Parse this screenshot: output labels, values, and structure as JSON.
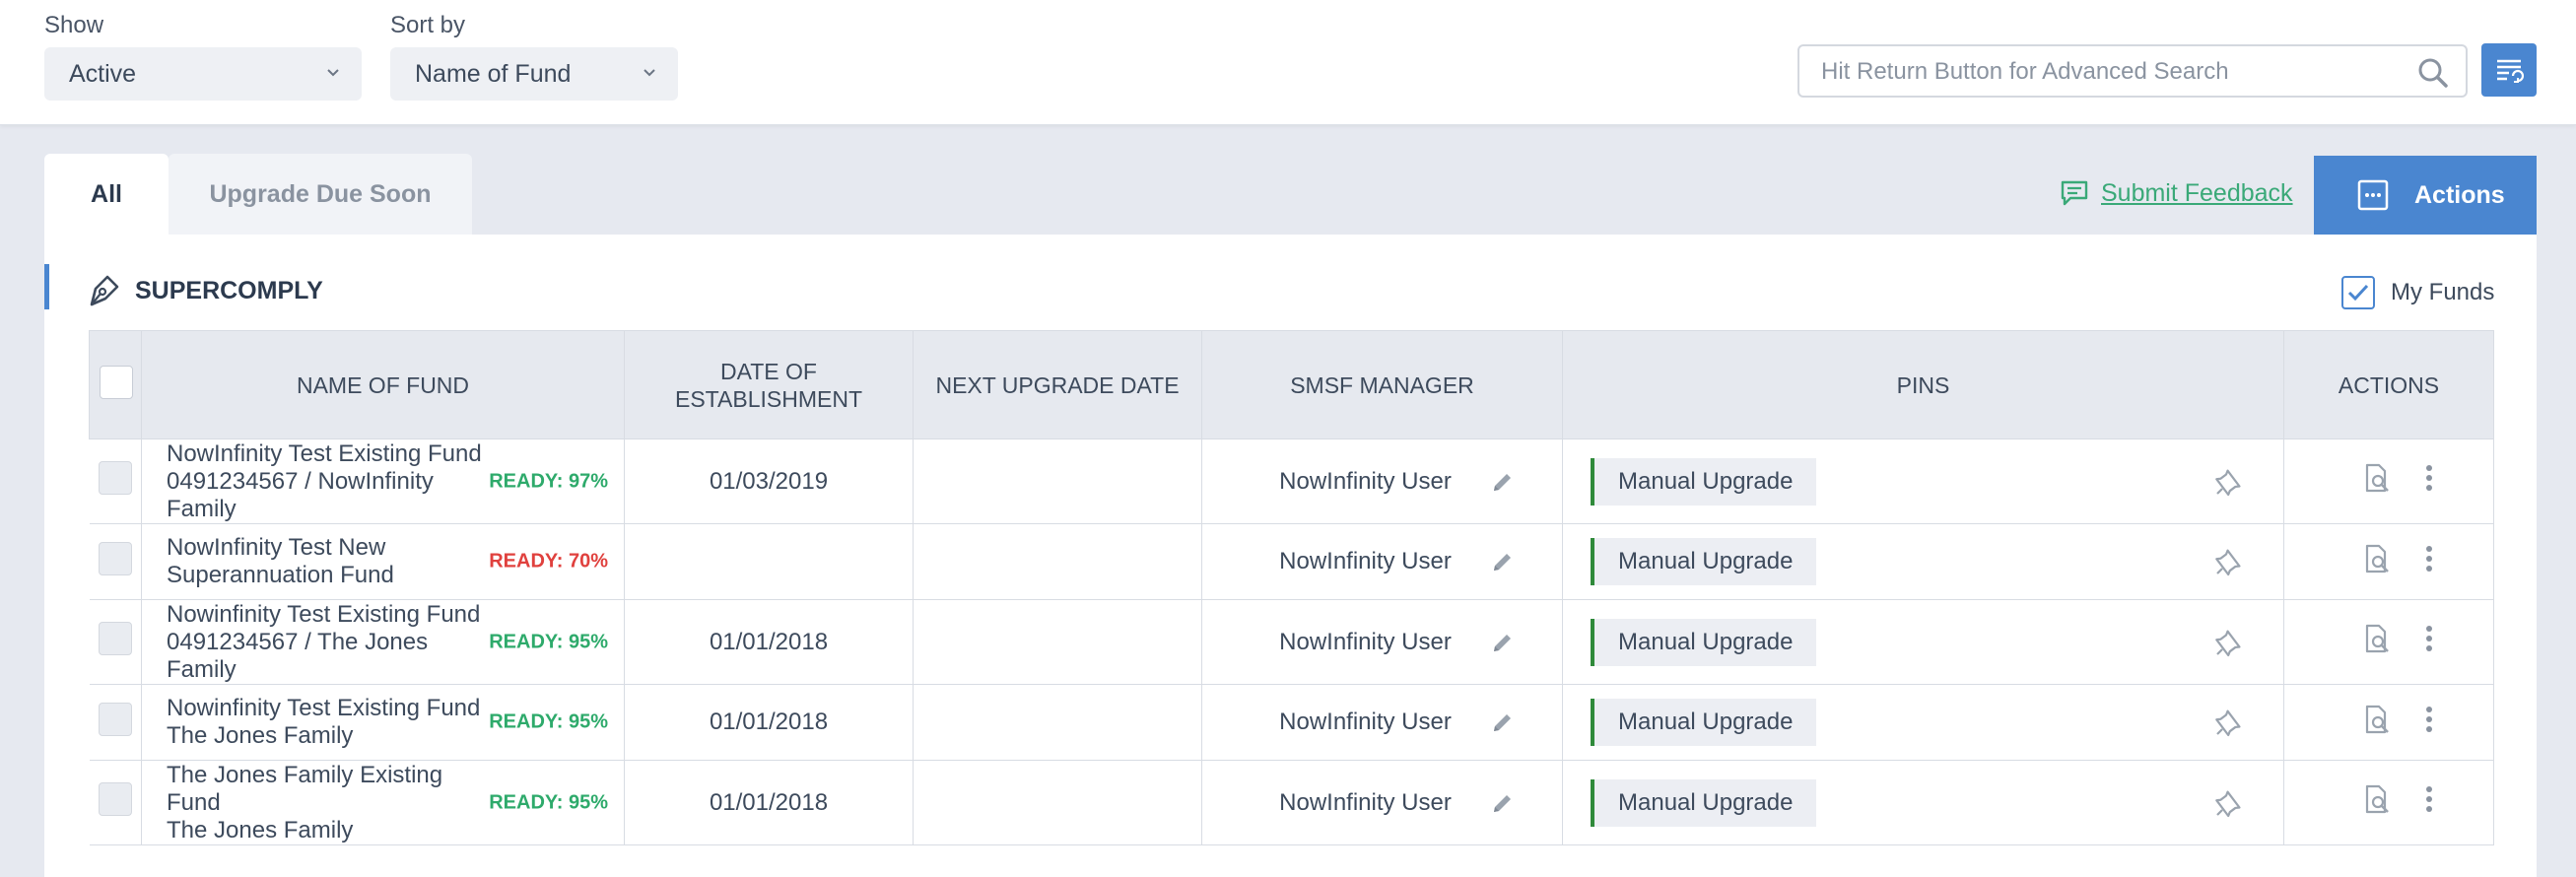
{
  "filters": {
    "show_label": "Show",
    "show_value": "Active",
    "sort_label": "Sort by",
    "sort_value": "Name of Fund"
  },
  "search": {
    "placeholder": "Hit Return Button for Advanced Search"
  },
  "tabs": [
    {
      "label": "All",
      "active": true
    },
    {
      "label": "Upgrade Due Soon",
      "active": false
    }
  ],
  "feedback_label": "Submit Feedback",
  "actions_label": "Actions",
  "section": {
    "title": "SUPERCOMPLY",
    "my_funds_label": "My Funds",
    "my_funds_checked": true
  },
  "table": {
    "columns": [
      "NAME OF FUND",
      "DATE OF ESTABLISHMENT",
      "NEXT UPGRADE DATE",
      "SMSF MANAGER",
      "PINS",
      "ACTIONS"
    ],
    "rows": [
      {
        "name_lines": [
          "NowInfinity Test Existing Fund",
          "0491234567 / NowInfinity",
          "Family"
        ],
        "ready": "READY: 97%",
        "ready_color": "#2eaa6b",
        "date": "01/03/2019",
        "next_upgrade": "",
        "manager": "NowInfinity User",
        "pin": "Manual Upgrade"
      },
      {
        "name_lines": [
          "NowInfinity Test New",
          "Superannuation Fund"
        ],
        "ready": "READY: 70%",
        "ready_color": "#e0413e",
        "date": "",
        "next_upgrade": "",
        "manager": "NowInfinity User",
        "pin": "Manual Upgrade"
      },
      {
        "name_lines": [
          "Nowinfinity Test Existing Fund",
          "0491234567 / The Jones",
          "Family"
        ],
        "ready": "READY: 95%",
        "ready_color": "#2eaa6b",
        "date": "01/01/2018",
        "next_upgrade": "",
        "manager": "NowInfinity User",
        "pin": "Manual Upgrade"
      },
      {
        "name_lines": [
          "Nowinfinity Test Existing Fund",
          "The Jones Family"
        ],
        "ready": "READY: 95%",
        "ready_color": "#2eaa6b",
        "date": "01/01/2018",
        "next_upgrade": "",
        "manager": "NowInfinity User",
        "pin": "Manual Upgrade"
      },
      {
        "name_lines": [
          "The Jones Family Existing",
          "Fund",
          "The Jones Family"
        ],
        "ready": "READY: 95%",
        "ready_color": "#2eaa6b",
        "date": "01/01/2018",
        "next_upgrade": "",
        "manager": "NowInfinity User",
        "pin": "Manual Upgrade"
      }
    ]
  },
  "colors": {
    "accent": "#4a86d0",
    "ready_green": "#2eaa6b",
    "ready_red": "#e0413e",
    "pin_bar": "#2f8a3a",
    "feedback": "#3aa978"
  },
  "icons": [
    "chevron-down-icon",
    "search-icon",
    "list-settings-icon",
    "feedback-icon",
    "actions-menu-icon",
    "pen-nib-icon",
    "checkmark-icon",
    "edit-pencil-icon",
    "pin-icon",
    "view-document-icon",
    "more-vertical-icon"
  ]
}
